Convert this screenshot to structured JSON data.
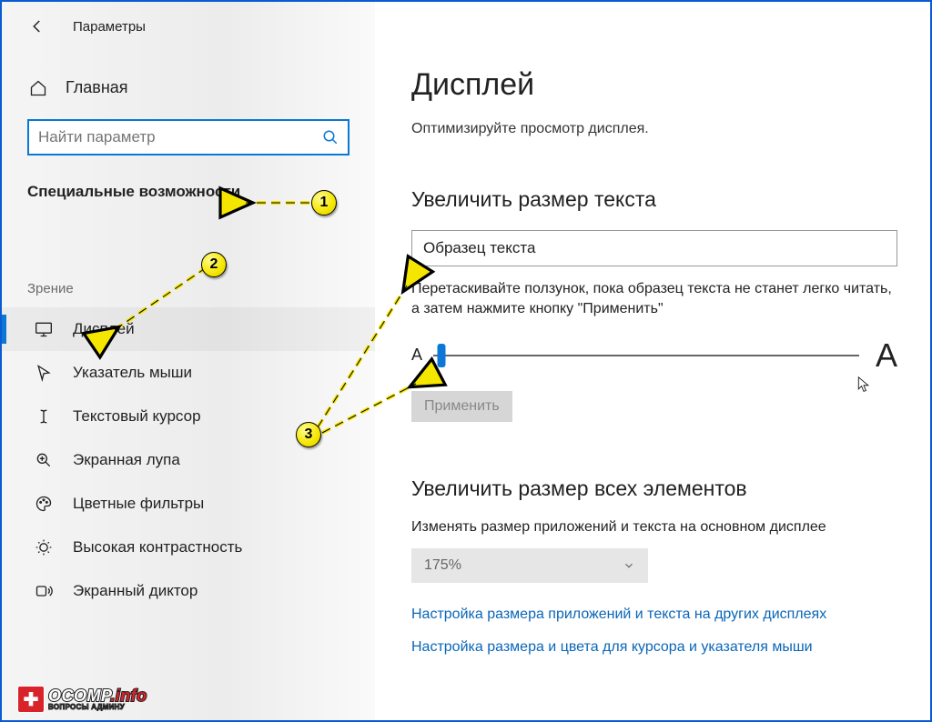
{
  "header": {
    "title": "Параметры"
  },
  "sidebar": {
    "home": "Главная",
    "search_placeholder": "Найти параметр",
    "category": "Специальные возможности",
    "group": "Зрение",
    "items": [
      {
        "label": "Дисплей"
      },
      {
        "label": "Указатель мыши"
      },
      {
        "label": "Текстовый курсор"
      },
      {
        "label": "Экранная лупа"
      },
      {
        "label": "Цветные фильтры"
      },
      {
        "label": "Высокая контрастность"
      },
      {
        "label": "Экранный диктор"
      }
    ]
  },
  "main": {
    "title": "Дисплей",
    "subtitle": "Оптимизируйте просмотр дисплея.",
    "section1_title": "Увеличить размер текста",
    "sample": "Образец текста",
    "hint": "Перетаскивайте ползунок, пока образец текста не станет легко читать, а затем нажмите кнопку \"Применить\"",
    "small_a": "A",
    "big_a": "A",
    "apply": "Применить",
    "section2_title": "Увеличить размер всех элементов",
    "scale_label": "Изменять размер приложений и текста на основном дисплее",
    "scale_value": "175%",
    "link1": "Настройка размера приложений и текста на других дисплеях",
    "link2": "Настройка размера и цвета для курсора и указателя мыши"
  },
  "annotations": {
    "b1": "1",
    "b2": "2",
    "b3": "3"
  },
  "watermark": {
    "brand": "OCOMP",
    "domain": ".info",
    "sub": "ВОПРОСЫ АДМИНУ"
  }
}
